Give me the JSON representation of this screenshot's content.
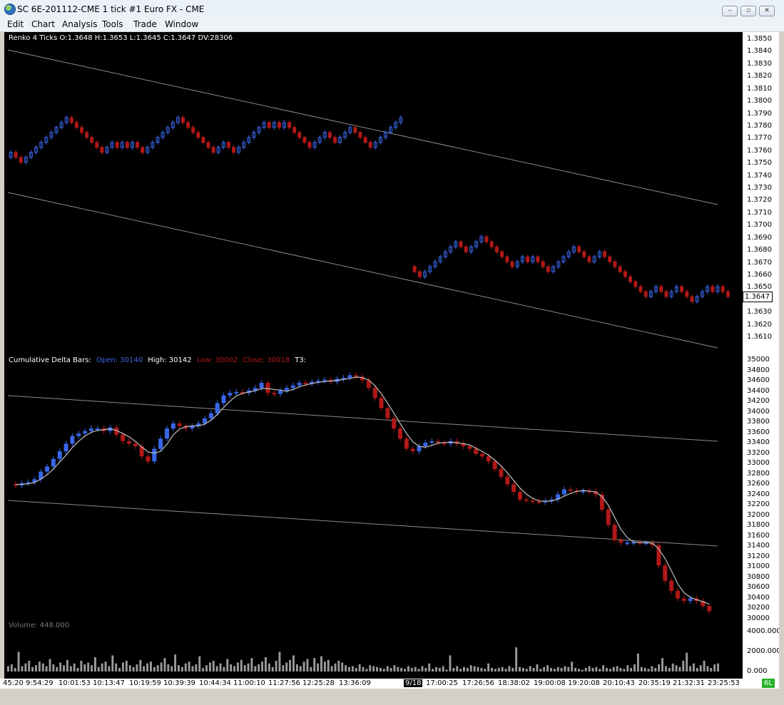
{
  "window": {
    "title": "SC 6E-201112-CME  1 tick  #1  Euro FX - CME",
    "minimize_glyph": "‒",
    "maximize_glyph": "▫",
    "close_glyph": "✕"
  },
  "menu": [
    "Edit",
    "Chart",
    "Analysis",
    "Tools",
    "Trade",
    "Window"
  ],
  "colors": {
    "up": "#3a66e8",
    "down": "#b01818",
    "volume": "#9a9a9a",
    "line": "#8a8a8a"
  },
  "renko": {
    "header": "Renko 4 Ticks O:1.3648 H:1.3653 L:1.3645 C:1.3647 DV:28306",
    "axis_labels": [
      "1.3850",
      "1.3840",
      "1.3830",
      "1.3820",
      "1.3810",
      "1.3800",
      "1.3790",
      "1.3780",
      "1.3770",
      "1.3760",
      "1.3750",
      "1.3740",
      "1.3730",
      "1.3720",
      "1.3710",
      "1.3700",
      "1.3690",
      "1.3680",
      "1.3670",
      "1.3660",
      "1.3650",
      "1.3640",
      "1.3630",
      "1.3620",
      "1.3610"
    ],
    "last_price": "1.3647"
  },
  "delta": {
    "header_prefix": "Cumulative Delta Bars:",
    "open": "Open: 30140",
    "high": "High: 30142",
    "low": "Low: 30002",
    "close": "Close: 30018",
    "t3": "T3:",
    "axis_labels": [
      "35000",
      "34800",
      "34600",
      "34400",
      "34200",
      "34000",
      "33800",
      "33600",
      "33400",
      "33200",
      "33000",
      "32800",
      "32600",
      "32400",
      "32200",
      "32000",
      "31800",
      "31600",
      "31400",
      "31200",
      "31000",
      "30800",
      "30600",
      "30400",
      "30200",
      "30000"
    ]
  },
  "volume": {
    "header": "Volume: 448.000",
    "axis_labels": [
      "4000.000",
      "2000.000",
      "0.000"
    ]
  },
  "time_axis": [
    "45:20",
    "9:54:29",
    "10:01:53",
    "10:13:47",
    "10:19:59",
    "10:39:39",
    "10:44:34",
    "11:00:10",
    "11:27:56",
    "12:25:28",
    "13:36:09",
    "9/18",
    "17:00:25",
    "17:26:56",
    "18:38:02",
    "19:00:08",
    "19:20:08",
    "20:10:43",
    "20:35:19",
    "21:32:31",
    "23:25:53"
  ],
  "symbol_badge": "6L",
  "chart_data": [
    {
      "type": "renko",
      "title": "Renko 4 Ticks",
      "ylim": [
        1.3605,
        1.3855
      ],
      "close_path": [
        1.376,
        1.3764,
        1.376,
        1.3756,
        1.376,
        1.3764,
        1.3768,
        1.3772,
        1.3776,
        1.378,
        1.3784,
        1.3788,
        1.3792,
        1.3788,
        1.3784,
        1.378,
        1.3776,
        1.3772,
        1.3768,
        1.3764,
        1.3768,
        1.3772,
        1.3768,
        1.3772,
        1.3768,
        1.3772,
        1.3768,
        1.3764,
        1.3768,
        1.3772,
        1.3776,
        1.378,
        1.3784,
        1.3788,
        1.3792,
        1.3788,
        1.3784,
        1.378,
        1.3776,
        1.3772,
        1.3768,
        1.3764,
        1.3768,
        1.3772,
        1.3768,
        1.3764,
        1.3768,
        1.3772,
        1.3776,
        1.378,
        1.3784,
        1.3788,
        1.3784,
        1.3788,
        1.3784,
        1.3788,
        1.3784,
        1.378,
        1.3776,
        1.3772,
        1.3768,
        1.3772,
        1.3776,
        1.378,
        1.3776,
        1.3772,
        1.3776,
        1.378,
        1.3784,
        1.378,
        1.3776,
        1.3772,
        1.3768,
        1.3772,
        1.3776,
        1.378,
        1.3784,
        1.3788,
        1.3792
      ],
      "close_path_2": [
        1.3672,
        1.3668,
        1.3664,
        1.3668,
        1.3672,
        1.3676,
        1.368,
        1.3684,
        1.3688,
        1.3692,
        1.3688,
        1.3684,
        1.3688,
        1.3692,
        1.3696,
        1.3692,
        1.3688,
        1.3684,
        1.368,
        1.3676,
        1.3672,
        1.3676,
        1.368,
        1.3676,
        1.368,
        1.3676,
        1.3672,
        1.3668,
        1.3672,
        1.3676,
        1.368,
        1.3684,
        1.3688,
        1.3684,
        1.368,
        1.3676,
        1.368,
        1.3684,
        1.368,
        1.3676,
        1.3672,
        1.3668,
        1.3664,
        1.366,
        1.3656,
        1.3652,
        1.3648,
        1.3652,
        1.3656,
        1.3652,
        1.3648,
        1.3652,
        1.3656,
        1.3652,
        1.3648,
        1.3644,
        1.3648,
        1.3652,
        1.3656,
        1.3652,
        1.3656,
        1.3652,
        1.3648
      ]
    },
    {
      "type": "bar",
      "title": "Cumulative Delta Bars",
      "ylim": [
        29950,
        35050
      ],
      "values": [
        32600,
        32580,
        32620,
        32640,
        32700,
        32850,
        32950,
        33100,
        33250,
        33400,
        33550,
        33600,
        33650,
        33700,
        33700,
        33650,
        33720,
        33580,
        33450,
        33400,
        33350,
        33150,
        33050,
        33300,
        33500,
        33700,
        33800,
        33750,
        33700,
        33750,
        33800,
        33900,
        34000,
        34200,
        34350,
        34400,
        34420,
        34400,
        34450,
        34500,
        34600,
        34400,
        34380,
        34450,
        34500,
        34550,
        34600,
        34580,
        34620,
        34640,
        34660,
        34620,
        34680,
        34700,
        34750,
        34720,
        34650,
        34500,
        34300,
        34100,
        33900,
        33700,
        33500,
        33300,
        33250,
        33350,
        33420,
        33450,
        33420,
        33400,
        33450,
        33400,
        33350,
        33300,
        33200,
        33150,
        33050,
        32900,
        32750,
        32600,
        32450,
        32300,
        32280,
        32260,
        32250,
        32270,
        32300,
        32400,
        32500,
        32480,
        32460,
        32470,
        32460,
        32400,
        32100,
        31800,
        31500,
        31450,
        31450,
        31460,
        31450,
        31450,
        31400,
        31000,
        30700,
        30500,
        30350,
        30300,
        30350,
        30300,
        30200,
        30100
      ]
    },
    {
      "type": "bar",
      "title": "Volume",
      "ylim": [
        0,
        4700
      ],
      "values": [
        600,
        800,
        400,
        2200,
        600,
        900,
        1200,
        500,
        700,
        1100,
        900,
        600,
        1400,
        800,
        500,
        1000,
        700,
        1300,
        600,
        900,
        400,
        1200,
        800,
        1000,
        700,
        1600,
        500,
        900,
        1100,
        600,
        1800,
        900,
        400,
        1000,
        1200,
        700,
        500,
        800,
        1300,
        600,
        900,
        1100,
        500,
        700,
        1000,
        1500,
        800,
        600,
        1900,
        700,
        500,
        900,
        1100,
        600,
        800,
        1700,
        400,
        700,
        1000,
        1200,
        600,
        900,
        500,
        1400,
        800,
        600,
        1000,
        1300,
        700,
        900,
        1500,
        600,
        800,
        1100,
        1600,
        900,
        500,
        1200,
        2200,
        700,
        1000,
        1300,
        1800,
        800,
        600,
        1100,
        1400,
        500,
        1500,
        900,
        1700,
        1100,
        1300,
        600,
        900,
        1200,
        1000,
        700,
        500,
        600,
        400,
        800,
        500,
        300,
        700,
        600,
        500,
        400,
        300,
        600,
        400,
        700,
        500,
        400,
        300,
        600,
        400,
        500,
        300,
        600,
        400,
        900,
        300,
        500,
        400,
        600,
        200,
        1800,
        400,
        600,
        300,
        500,
        400,
        700,
        600,
        500,
        400,
        300,
        900,
        400,
        300,
        400,
        500,
        300,
        600,
        400,
        2700,
        500,
        400,
        300,
        600,
        400,
        800,
        300,
        500,
        700,
        400,
        300,
        500,
        400,
        600,
        500,
        1100,
        400,
        300,
        200,
        400,
        600,
        400,
        500,
        300,
        700,
        400,
        300,
        500,
        600,
        400,
        300,
        700,
        400,
        800,
        2000,
        500,
        400,
        300,
        600,
        400,
        800,
        1500,
        600,
        400,
        900,
        700,
        500,
        1200,
        2100,
        600,
        900,
        400,
        700,
        1200,
        600,
        400,
        800,
        900
      ]
    }
  ]
}
